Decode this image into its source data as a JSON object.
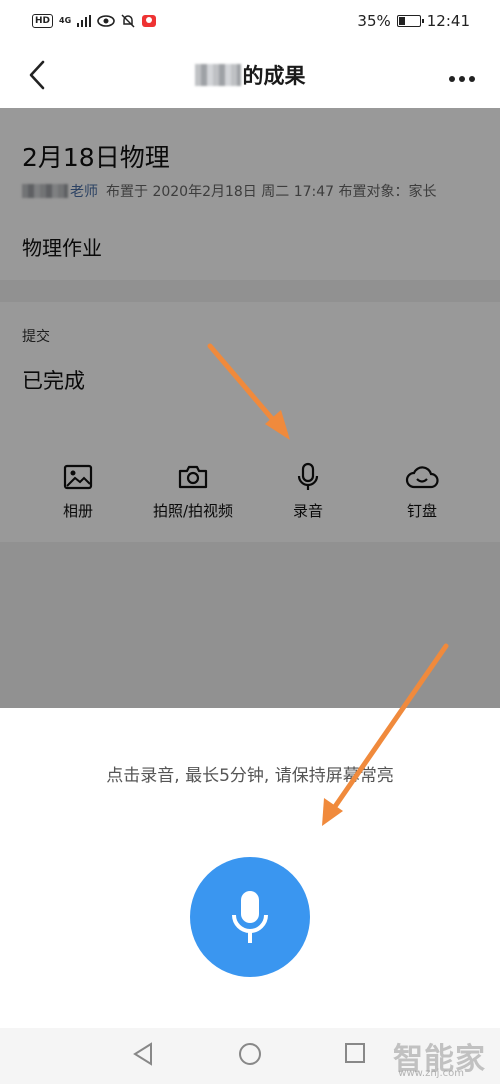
{
  "status_bar": {
    "hd": "HD",
    "network": "4G",
    "battery_percent": "35%",
    "battery_level": 0.35,
    "time": "12:41"
  },
  "nav": {
    "title_suffix": "的成果",
    "back_icon": "chevron-left-icon",
    "more_icon": "more-dots-icon"
  },
  "assignment": {
    "title": "2月18日物理",
    "teacher_suffix": "老师",
    "meta": "布置于 2020年2月18日 周二 17:47 布置对象：家长",
    "description": "物理作业"
  },
  "submission": {
    "label": "提交",
    "status": "已完成",
    "tools": [
      {
        "icon": "image-icon",
        "label": "相册"
      },
      {
        "icon": "camera-icon",
        "label": "拍照/拍视频"
      },
      {
        "icon": "microphone-icon",
        "label": "录音"
      },
      {
        "icon": "cloud-icon",
        "label": "钉盘"
      }
    ]
  },
  "record_sheet": {
    "hint": "点击录音, 最长5分钟, 请保持屏幕常亮",
    "record_icon": "microphone-icon"
  },
  "watermark": {
    "text": "智能家",
    "url": "www.znj.com"
  },
  "colors": {
    "accent": "#3a96f0",
    "arrow": "#f08a3c",
    "teacher_text": "#4a6fa5"
  }
}
